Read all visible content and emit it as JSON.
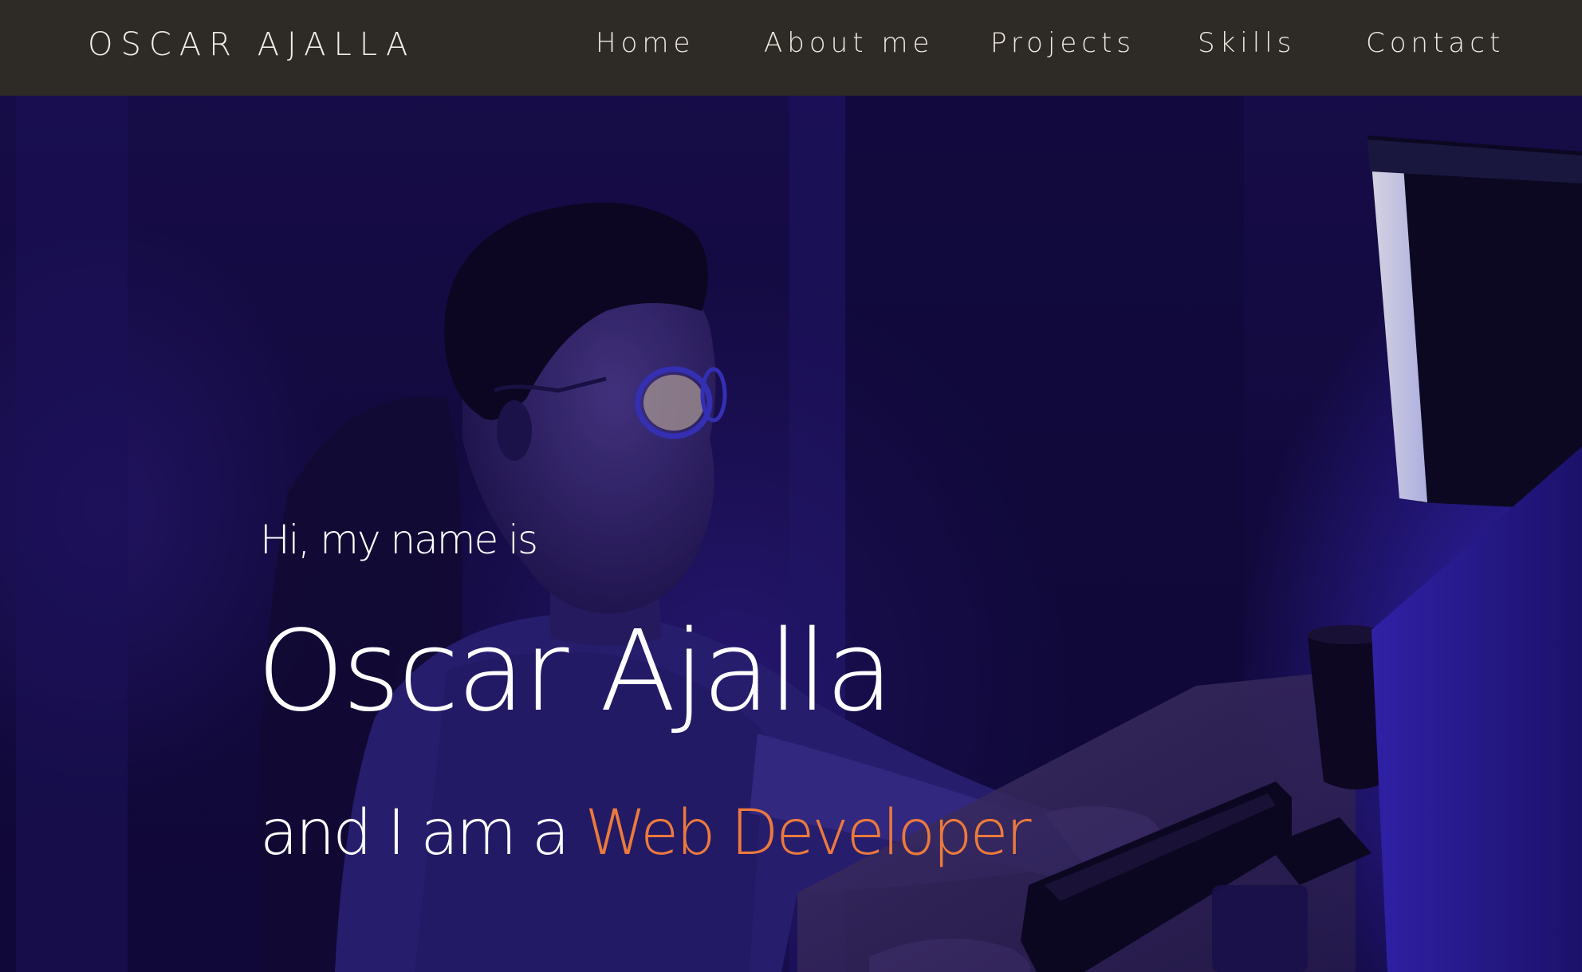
{
  "brand": "OSCAR AJALLA",
  "nav": {
    "home": "Home",
    "about": "About me",
    "projects": "Projects",
    "skills": "Skills",
    "contact": "Contact"
  },
  "hero": {
    "greeting": "Hi, my name is",
    "name": "Oscar Ajalla",
    "tagline_prefix": "and I am a ",
    "role": "Web Developer"
  },
  "colors": {
    "navbar_bg": "#2e2a26",
    "accent": "#ec7a3c",
    "hero_tint": "#170d45",
    "text": "#ffffff"
  }
}
